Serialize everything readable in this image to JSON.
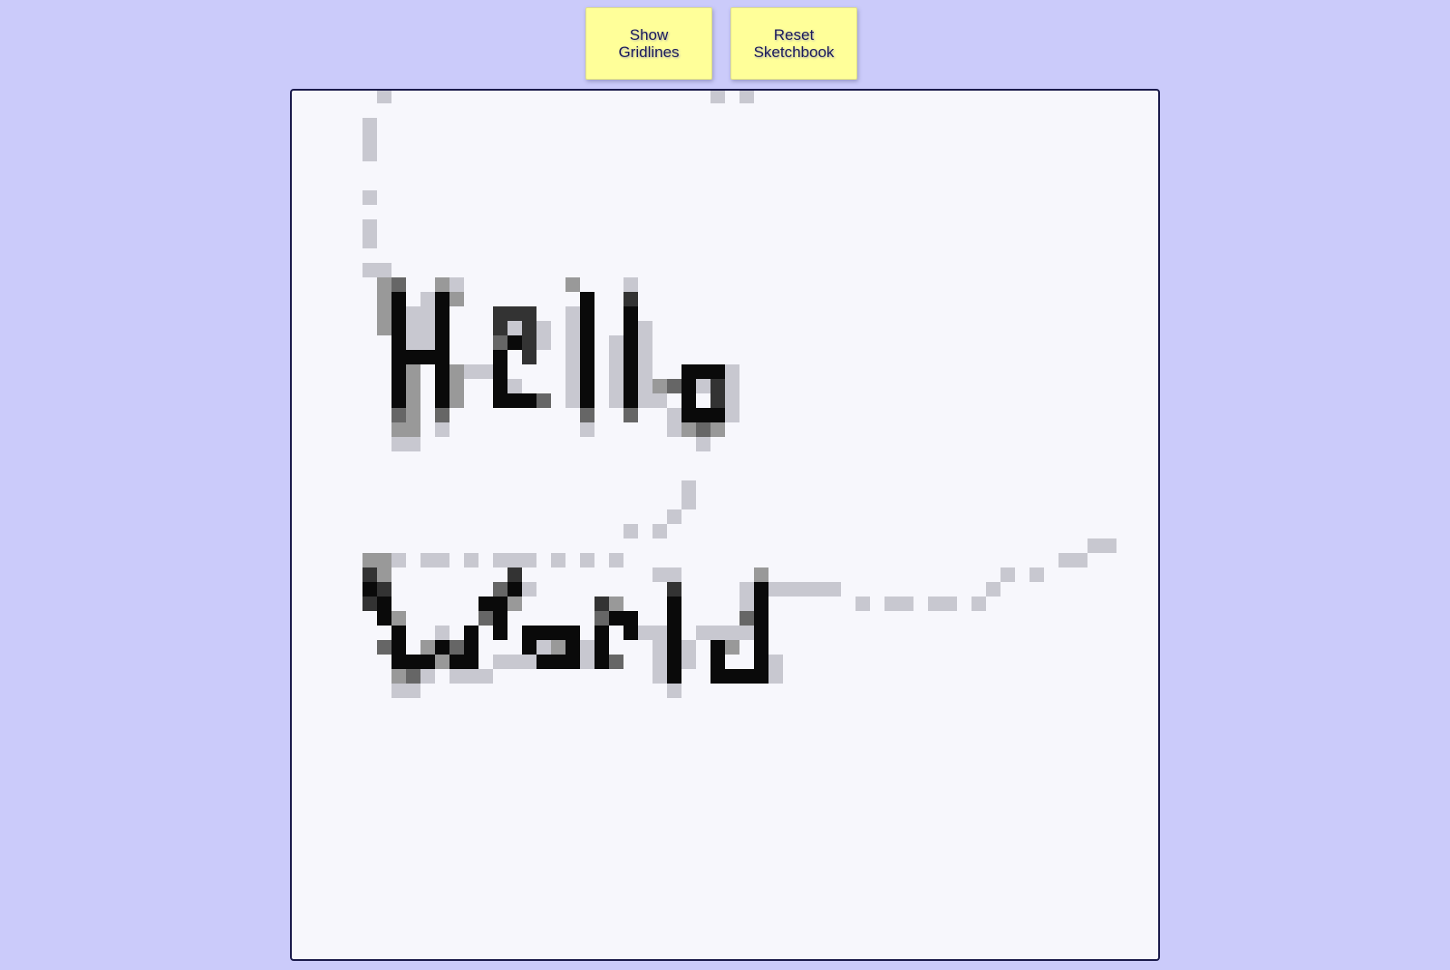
{
  "toolbar": {
    "gridlines_button": {
      "line1": "Show",
      "line2": "Gridlines"
    },
    "reset_button": {
      "line1": "Reset",
      "line2": "Sketchbook"
    }
  },
  "sketchbook": {
    "background_color": "#f7f7fc",
    "border_color": "#1a1a4a",
    "drawn_text": "Hello World",
    "ink_colors": [
      "#0a0a0a",
      "#333333",
      "#666666",
      "#999999",
      "#c8c8d0"
    ]
  },
  "colors": {
    "page_background": "#cbcbfa",
    "button_background": "#ffff99",
    "button_text": "#1a1a5a"
  }
}
